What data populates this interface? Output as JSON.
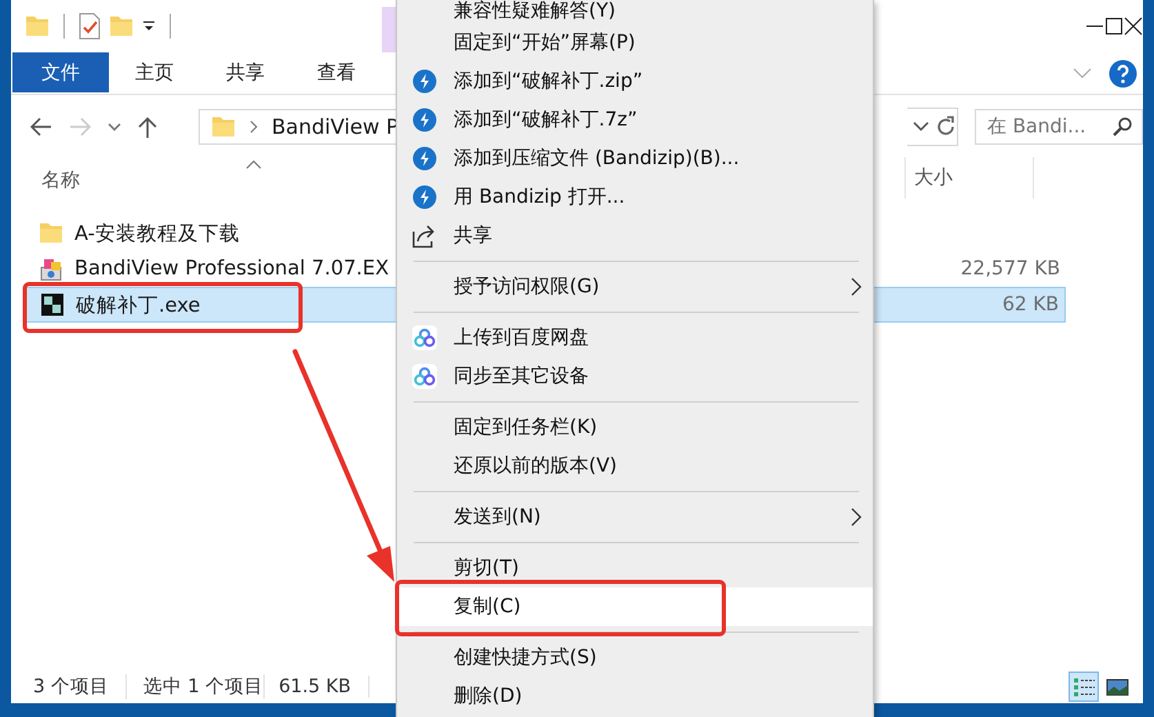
{
  "ribbon_tabs": [
    {
      "label": "文件",
      "selected": true
    },
    {
      "label": "主页",
      "selected": false
    },
    {
      "label": "共享",
      "selected": false
    },
    {
      "label": "查看",
      "selected": false
    }
  ],
  "address": {
    "path": "BandiView P"
  },
  "search": {
    "placeholder": "在 Bandi..."
  },
  "columns": [
    {
      "label": "名称",
      "sorted": true
    },
    {
      "label": "大小",
      "sorted": false
    }
  ],
  "files": [
    {
      "name": "A-安装教程及下载",
      "kind": "folder",
      "selected": false
    },
    {
      "name": "BandiView Professional 7.07.EX",
      "kind": "installer",
      "size": "22,577 KB",
      "selected": false
    },
    {
      "name": "破解补丁.exe",
      "kind": "program",
      "size": "62 KB",
      "selected": true
    }
  ],
  "status_bar": {
    "count": "3 个项目",
    "selection": "选中 1 个项目",
    "size": "61.5 KB"
  },
  "view_buttons": [
    {
      "kind": "details",
      "selected": true
    },
    {
      "kind": "thumbnails",
      "selected": false
    }
  ],
  "context_menu": [
    {
      "kind": "item",
      "label": "兼容性疑难解答(Y)",
      "selected": false
    },
    {
      "kind": "item",
      "label": "固定到“开始”屏幕(P)",
      "selected": false
    },
    {
      "kind": "archive",
      "label": "添加到“破解补丁.zip”",
      "selected": false
    },
    {
      "kind": "archive",
      "label": "添加到“破解补丁.7z”",
      "selected": false
    },
    {
      "kind": "archive",
      "label": "添加到压缩文件 (Bandizip)(B)...",
      "selected": false
    },
    {
      "kind": "archive",
      "label": "用 Bandizip 打开...",
      "selected": false
    },
    {
      "kind": "share",
      "label": "共享",
      "selected": false
    },
    {
      "kind": "separator"
    },
    {
      "kind": "submenu",
      "label": "授予访问权限(G)",
      "selected": false
    },
    {
      "kind": "separator"
    },
    {
      "kind": "cloud",
      "label": "上传到百度网盘",
      "selected": false
    },
    {
      "kind": "cloud",
      "label": "同步至其它设备",
      "selected": false
    },
    {
      "kind": "separator"
    },
    {
      "kind": "item",
      "label": "固定到任务栏(K)",
      "selected": false
    },
    {
      "kind": "item",
      "label": "还原以前的版本(V)",
      "selected": false
    },
    {
      "kind": "separator"
    },
    {
      "kind": "submenu",
      "label": "发送到(N)",
      "selected": false
    },
    {
      "kind": "separator"
    },
    {
      "kind": "item",
      "label": "剪切(T)",
      "selected": false
    },
    {
      "kind": "item",
      "label": "复制(C)",
      "selected": true
    },
    {
      "kind": "separator"
    },
    {
      "kind": "item",
      "label": "创建快捷方式(S)",
      "selected": false
    },
    {
      "kind": "item",
      "label": "删除(D)",
      "selected": false
    }
  ]
}
